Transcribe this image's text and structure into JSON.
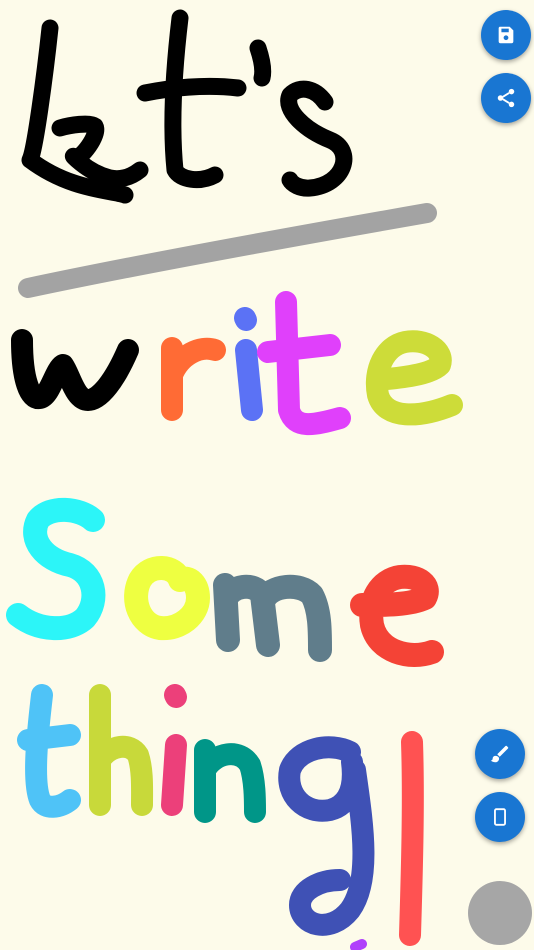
{
  "theme": {
    "canvas_background": "#FDFBEA",
    "fab_color": "#1976D2",
    "icon_color": "#FFFFFF"
  },
  "toolbar_top": {
    "save_icon": "floppy-disk",
    "share_icon": "share-nodes"
  },
  "toolbar_bottom": {
    "brush_icon": "paint-brush",
    "eraser_icon": "eraser",
    "current_color": "#A6A6A6"
  },
  "drawing": {
    "ink_colors": {
      "black": "#000000",
      "gray": "#A3A3A3",
      "orange": "#FF6B35",
      "blue": "#5B72F5",
      "magenta": "#E040FB",
      "lime": "#CDDC39",
      "cyan": "#2CF5F8",
      "yellow": "#EEFF41",
      "slate": "#607D8B",
      "red": "#F44336",
      "sky": "#4FC3F7",
      "olive": "#C8D93A",
      "pink": "#EC407A",
      "teal": "#009688",
      "indigo": "#3F51B5",
      "coral": "#FF5252",
      "purple": "#B040FB"
    }
  }
}
